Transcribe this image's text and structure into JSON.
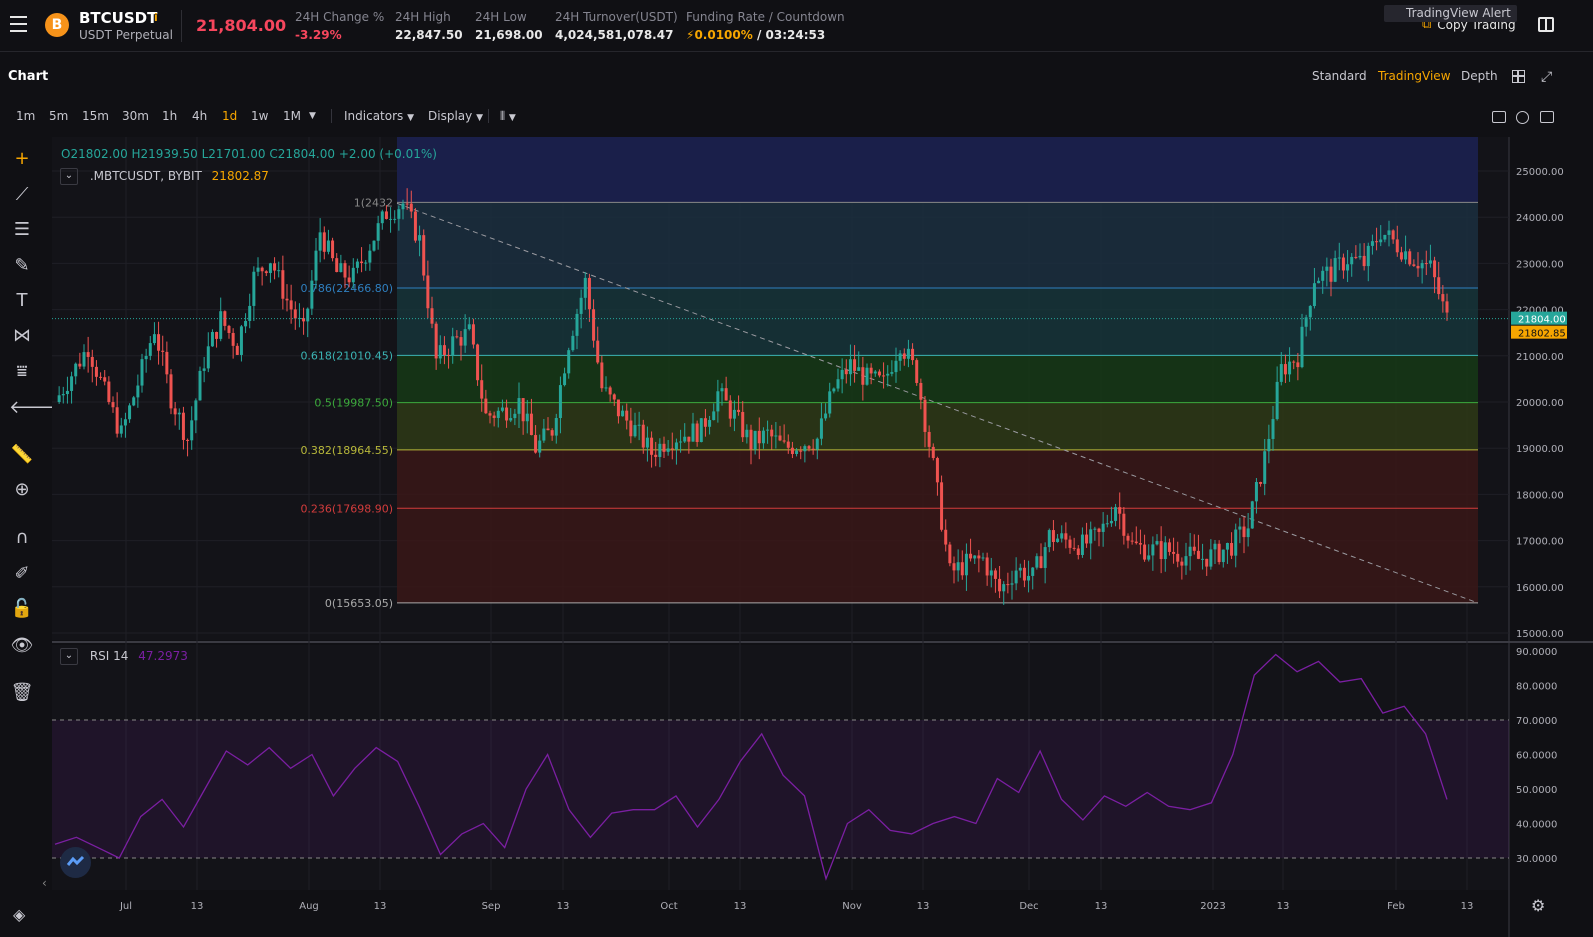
{
  "header": {
    "symbol": "BTCUSDT",
    "symbol_sub": "USDT Perpetual",
    "coin_icon": "B",
    "last_price": "21,804.00",
    "stats": [
      {
        "label": "24H Change %",
        "value": "-3.29%",
        "color": "#f6465d"
      },
      {
        "label": "24H High",
        "value": "22,847.50",
        "color": "#e8e8e8"
      },
      {
        "label": "24H Low",
        "value": "21,698.00",
        "color": "#e8e8e8"
      },
      {
        "label": "24H Turnover(USDT)",
        "value": "4,024,581,078.47",
        "color": "#e8e8e8"
      }
    ],
    "funding_label": "Funding Rate / Countdown",
    "funding_rate": "0.0100%",
    "funding_countdown": "/ 03:24:53",
    "copy_trading": "Copy Trading"
  },
  "chart_header": {
    "title": "Chart",
    "views": [
      "Standard",
      "TradingView",
      "Depth"
    ],
    "active_view": "TradingView"
  },
  "toolbar": {
    "timeframes": [
      "1m",
      "5m",
      "15m",
      "30m",
      "1h",
      "4h",
      "1d",
      "1w",
      "1M"
    ],
    "active_timeframe": "1d",
    "indicators": "Indicators",
    "display": "Display",
    "tv_alert": "TradingView Alert"
  },
  "legend": {
    "ohlc": "O21802.00  H21939.50  L21701.00  C21804.00  +2.00 (+0.01%)",
    "index_name": ".MBTCUSDT, BYBIT",
    "index_value": "21802.87",
    "rsi_name": "RSI 14",
    "rsi_value": "47.2973"
  },
  "colors": {
    "up": "#26a69a",
    "down": "#ef5350",
    "accent": "#f7a600",
    "rsi_line": "#7b1fa2"
  },
  "chart_data": {
    "type": "candlestick",
    "price_axis": [
      "25000.00",
      "24000.00",
      "23000.00",
      "22000.00",
      "21000.00",
      "20000.00",
      "19000.00",
      "18000.00",
      "17000.00",
      "16000.00",
      "15000.00"
    ],
    "price_labels": {
      "last": "21804.00",
      "index": "21802.85"
    },
    "fib_levels": [
      {
        "label": "1(2432",
        "value": 24320,
        "line": "#888888",
        "fill": "#2a2a2a"
      },
      {
        "label": "0.786(22466.80)",
        "value": 22466.8,
        "line": "#2f7fbf",
        "fill": "#1b2f3f"
      },
      {
        "label": "0.618(21010.45)",
        "value": 21010.45,
        "line": "#3bb5b5",
        "fill": "#16353a"
      },
      {
        "label": "0.5(19987.50)",
        "value": 19987.5,
        "line": "#3caa3c",
        "fill": "#163a16"
      },
      {
        "label": "0.382(18964.55)",
        "value": 18964.55,
        "line": "#b8b83a",
        "fill": "#2e3a16"
      },
      {
        "label": "0.236(17698.90)",
        "value": 17698.9,
        "line": "#d23c3c",
        "fill": "#3a1818"
      },
      {
        "label": "0(15653.05)",
        "value": 15653.05,
        "line": "#aaaaaa",
        "fill": "#3a1818"
      }
    ],
    "time_axis": [
      "Jul",
      "13",
      "Aug",
      "13",
      "Sep",
      "13",
      "Oct",
      "13",
      "Nov",
      "13",
      "Dec",
      "13",
      "2023",
      "13",
      "Feb",
      "13"
    ],
    "close_path": [
      [
        0,
        20000
      ],
      [
        4,
        20600
      ],
      [
        8,
        21200
      ],
      [
        12,
        20200
      ],
      [
        16,
        19300
      ],
      [
        20,
        20400
      ],
      [
        24,
        21600
      ],
      [
        28,
        20100
      ],
      [
        32,
        19200
      ],
      [
        36,
        20900
      ],
      [
        40,
        21800
      ],
      [
        44,
        21200
      ],
      [
        48,
        22700
      ],
      [
        52,
        23100
      ],
      [
        56,
        22200
      ],
      [
        60,
        21500
      ],
      [
        64,
        23700
      ],
      [
        68,
        22800
      ],
      [
        72,
        22700
      ],
      [
        76,
        23400
      ],
      [
        80,
        24100
      ],
      [
        84,
        24300
      ],
      [
        88,
        23500
      ],
      [
        92,
        20900
      ],
      [
        96,
        21300
      ],
      [
        100,
        21500
      ],
      [
        104,
        19700
      ],
      [
        108,
        19800
      ],
      [
        112,
        20000
      ],
      [
        116,
        19000
      ],
      [
        120,
        19400
      ],
      [
        124,
        21300
      ],
      [
        128,
        22600
      ],
      [
        132,
        20300
      ],
      [
        136,
        19800
      ],
      [
        140,
        19400
      ],
      [
        144,
        18900
      ],
      [
        148,
        19200
      ],
      [
        152,
        19300
      ],
      [
        156,
        19400
      ],
      [
        160,
        20200
      ],
      [
        164,
        19700
      ],
      [
        168,
        19100
      ],
      [
        172,
        19300
      ],
      [
        176,
        19000
      ],
      [
        180,
        19100
      ],
      [
        184,
        19200
      ],
      [
        188,
        20300
      ],
      [
        192,
        20800
      ],
      [
        196,
        20500
      ],
      [
        200,
        20400
      ],
      [
        204,
        21300
      ],
      [
        208,
        20600
      ],
      [
        212,
        18600
      ],
      [
        216,
        16300
      ],
      [
        220,
        16500
      ],
      [
        224,
        16600
      ],
      [
        228,
        15900
      ],
      [
        232,
        16400
      ],
      [
        236,
        16200
      ],
      [
        240,
        17100
      ],
      [
        244,
        17000
      ],
      [
        248,
        16900
      ],
      [
        252,
        17100
      ],
      [
        256,
        17800
      ],
      [
        260,
        16900
      ],
      [
        264,
        16800
      ],
      [
        268,
        16800
      ],
      [
        272,
        16700
      ],
      [
        276,
        16600
      ],
      [
        280,
        16700
      ],
      [
        284,
        16900
      ],
      [
        288,
        17300
      ],
      [
        292,
        18800
      ],
      [
        296,
        20700
      ],
      [
        300,
        21000
      ],
      [
        304,
        22700
      ],
      [
        308,
        22800
      ],
      [
        312,
        23100
      ],
      [
        316,
        23000
      ],
      [
        320,
        23700
      ],
      [
        324,
        23400
      ],
      [
        328,
        23100
      ],
      [
        332,
        22900
      ],
      [
        336,
        21804
      ]
    ],
    "rsi": {
      "levels": [
        "90.0000",
        "80.0000",
        "70.0000",
        "60.0000",
        "50.0000",
        "40.0000",
        "30.0000"
      ],
      "upper_band": 70,
      "lower_band": 30,
      "values": [
        34,
        36,
        33,
        30,
        42,
        47,
        39,
        50,
        61,
        57,
        62,
        56,
        60,
        48,
        56,
        62,
        58,
        45,
        31,
        37,
        40,
        33,
        50,
        60,
        44,
        36,
        43,
        44,
        44,
        48,
        39,
        47,
        58,
        66,
        54,
        48,
        24,
        40,
        44,
        38,
        37,
        40,
        42,
        40,
        53,
        49,
        61,
        47,
        41,
        48,
        45,
        49,
        45,
        44,
        46,
        60,
        83,
        89,
        84,
        87,
        81,
        82,
        72,
        74,
        66,
        47
      ]
    }
  }
}
